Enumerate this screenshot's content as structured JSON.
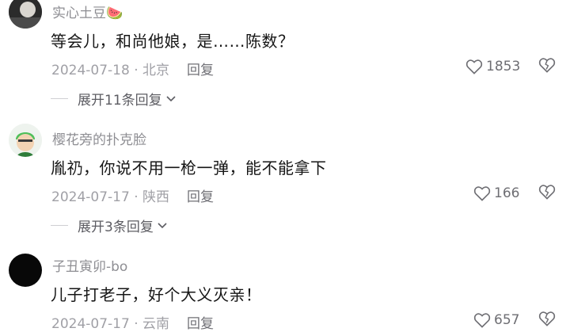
{
  "comments": [
    {
      "username": "实心土豆",
      "username_emoji": "🍉",
      "text": "等会儿，和尚他娘，是……陈数？",
      "date": "2024-07-18",
      "location": "北京",
      "reply_label": "回复",
      "likes": "1853",
      "expand_label": "展开11条回复"
    },
    {
      "username": "樱花旁的扑克脸",
      "text": "胤礽，你说不用一枪一弹，能不能拿下",
      "date": "2024-07-17",
      "location": "陕西",
      "reply_label": "回复",
      "likes": "166",
      "expand_label": "展开3条回复"
    },
    {
      "username": "子丑寅卯-bo",
      "text": "儿子打老子，好个大义灭亲！",
      "date": "2024-07-17",
      "location": "云南",
      "reply_label": "回复",
      "likes": "657"
    }
  ],
  "separator": "·",
  "colors": {
    "username": "#8e8e93",
    "text": "#161616",
    "meta": "#a0a0a6",
    "background": "#ffffff"
  }
}
